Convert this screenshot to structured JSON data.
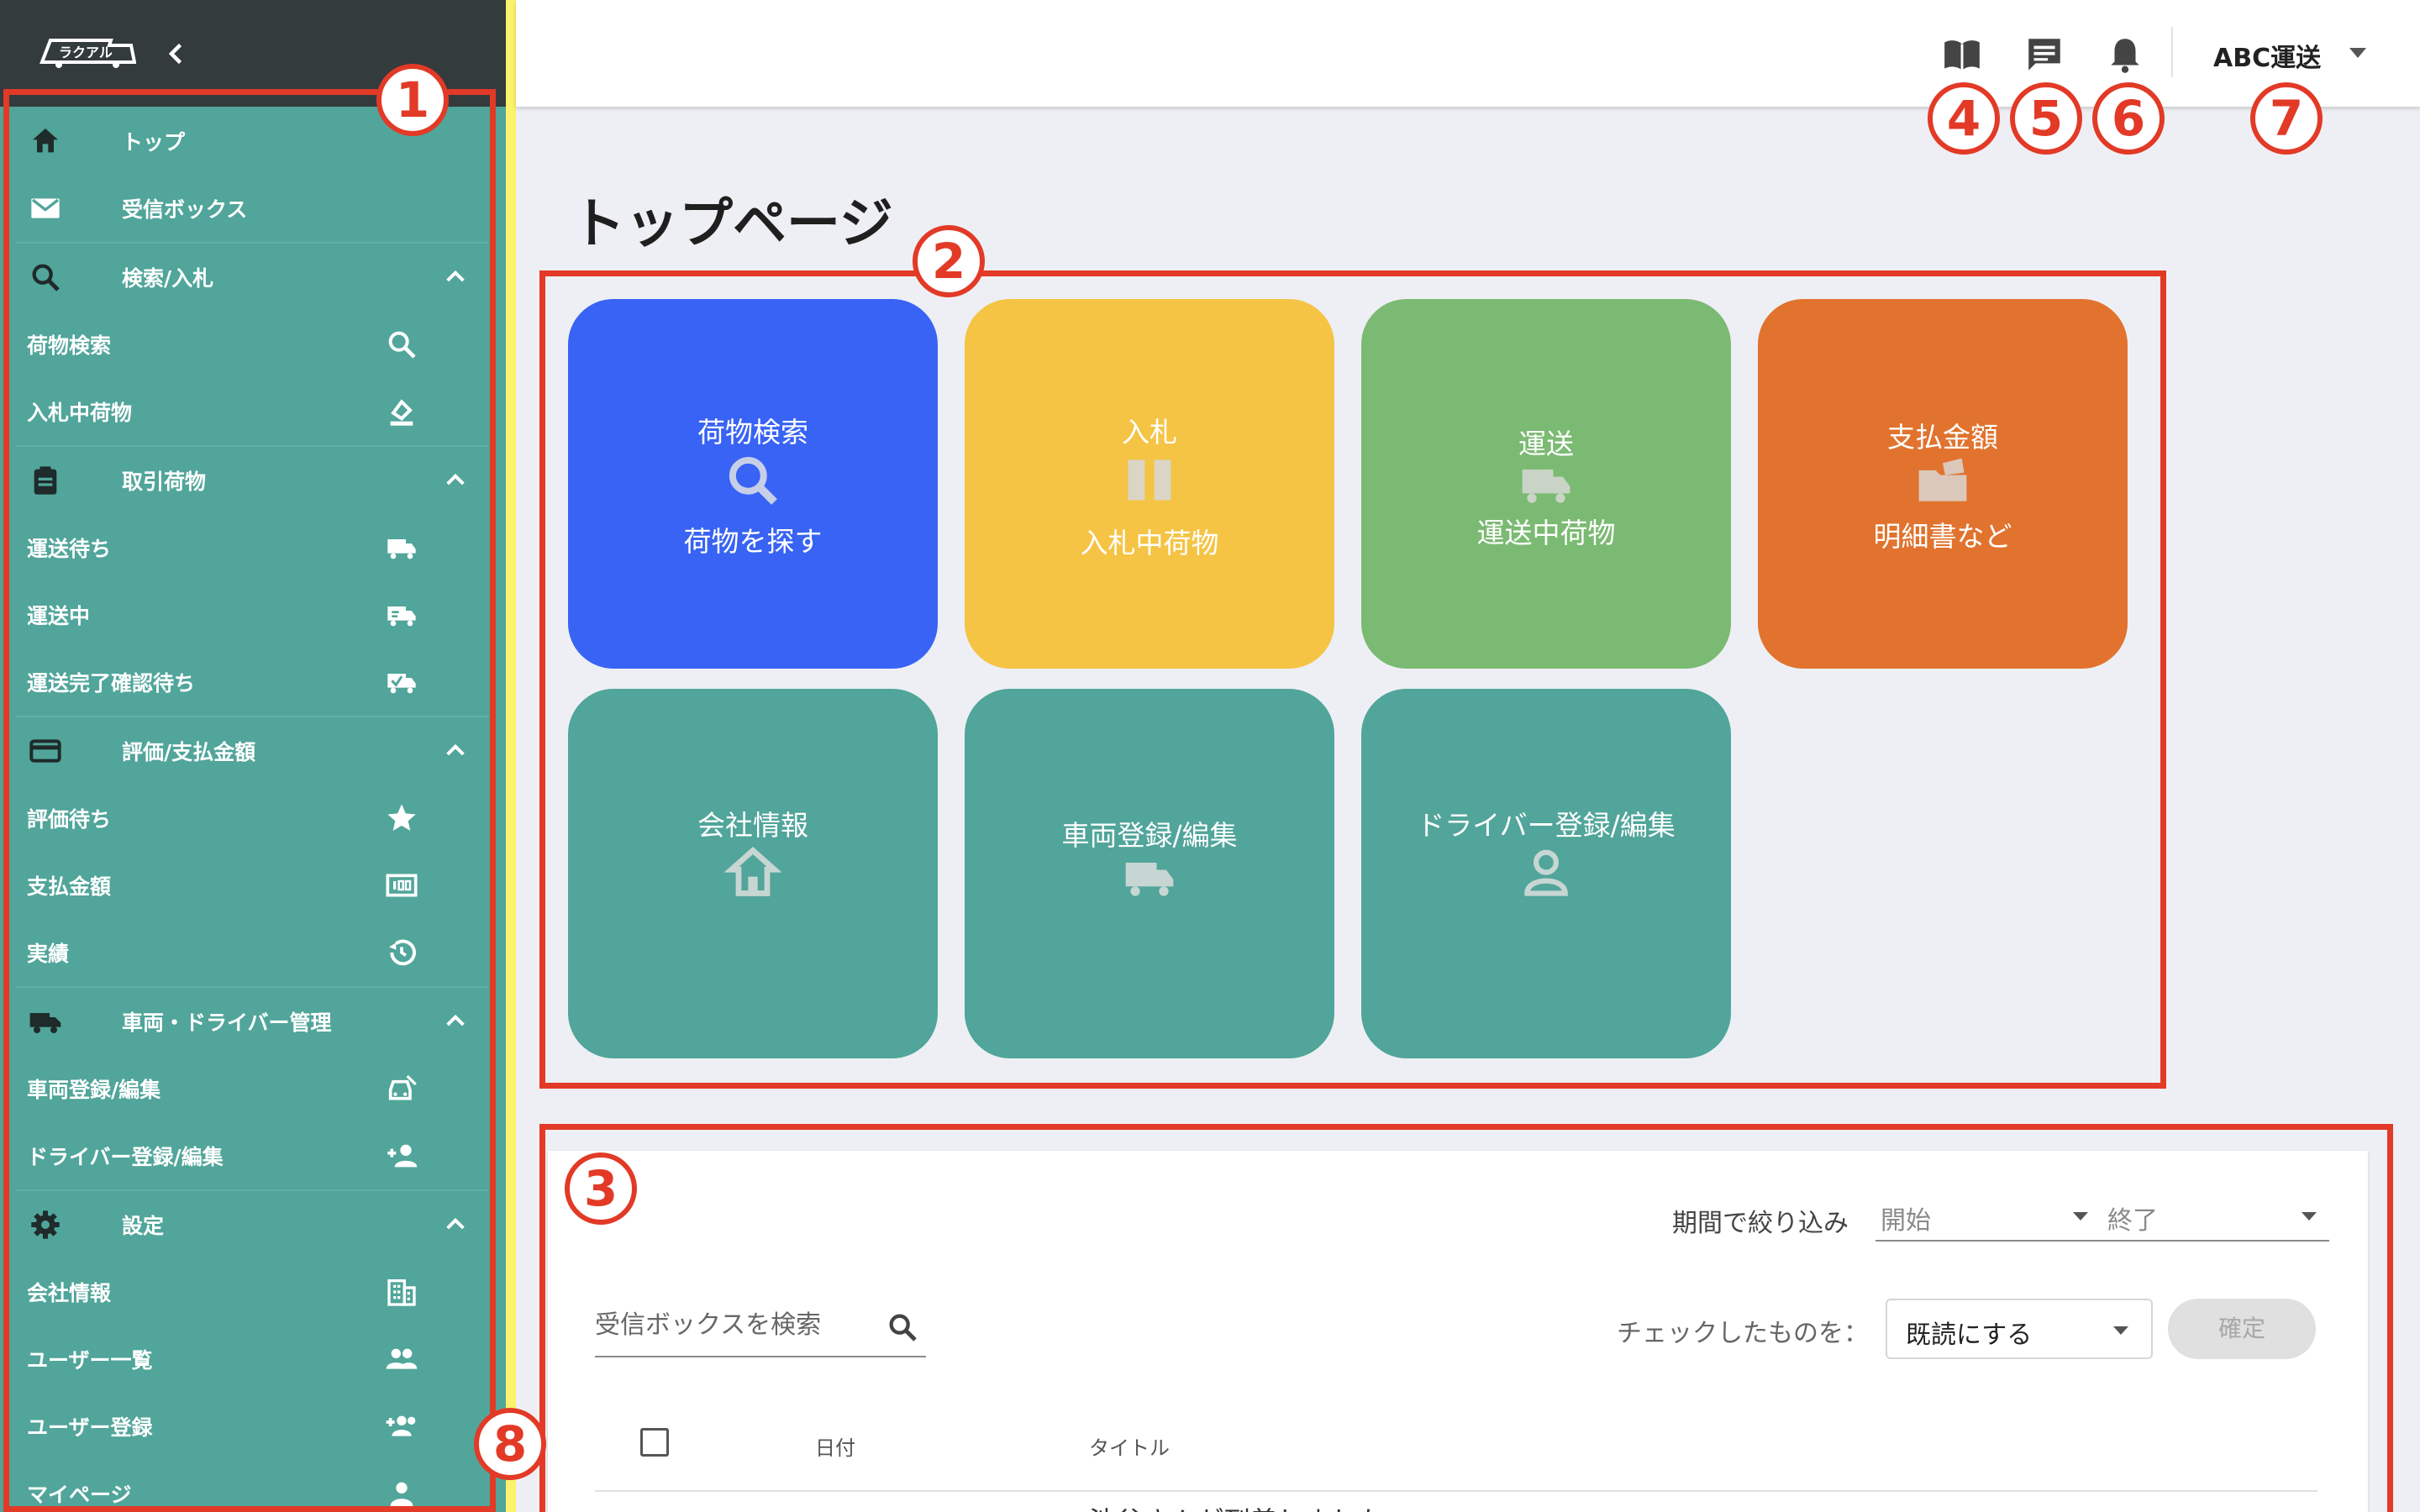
{
  "sidebar": {
    "logo_text": "ラクアル",
    "top": {
      "label": "トップ"
    },
    "inbox": {
      "label": "受信ボックス"
    },
    "sections": {
      "search": {
        "label": "検索/入札",
        "items": [
          "荷物検索",
          "入札中荷物"
        ]
      },
      "trades": {
        "label": "取引荷物",
        "items": [
          "運送待ち",
          "運送中",
          "運送完了確認待ち"
        ]
      },
      "review": {
        "label": "評価/支払金額",
        "items": [
          "評価待ち",
          "支払金額",
          "実績"
        ]
      },
      "vehicles": {
        "label": "車両・ドライバー管理",
        "items": [
          "車両登録/編集",
          "ドライバー登録/編集"
        ]
      },
      "settings": {
        "label": "設定",
        "items": [
          "会社情報",
          "ユーザー一覧",
          "ユーザー登録",
          "マイページ"
        ]
      }
    }
  },
  "header": {
    "company": "ABC運送"
  },
  "page_title": "トップページ",
  "tiles": [
    {
      "line1": "荷物検索",
      "line2": "荷物を探す",
      "color": "#3863f4"
    },
    {
      "line1": "入札",
      "line2": "入札中荷物",
      "color": "#f5c444"
    },
    {
      "line1": "運送",
      "line2": "運送中荷物",
      "color": "#7bba72"
    },
    {
      "line1": "支払金額",
      "line2": "明細書など",
      "color": "#e1732e"
    },
    {
      "line1": "会社情報",
      "line2": "",
      "color": "#51a59a"
    },
    {
      "line1": "車両登録/編集",
      "line2": "",
      "color": "#51a59a"
    },
    {
      "line1": "ドライバー登録/編集",
      "line2": "",
      "color": "#51a59a"
    }
  ],
  "inbox": {
    "filter_label": "期間で絞り込み",
    "start_placeholder": "開始",
    "end_placeholder": "終了",
    "search_placeholder": "受信ボックスを検索",
    "check_label": "チェックしたものを：",
    "action_value": "既読にする",
    "confirm_label": "確定",
    "columns": [
      "日付",
      "タイトル"
    ],
    "row_peek": "池谷さんが到着しました"
  },
  "annotations": [
    "1",
    "2",
    "3",
    "4",
    "5",
    "6",
    "7",
    "8"
  ],
  "colors": {
    "sidebar_bg": "#51a59a",
    "sidebar_header": "#343b3d",
    "annotation_red": "#e23a26",
    "yellow_strip": "#fbf36b"
  }
}
